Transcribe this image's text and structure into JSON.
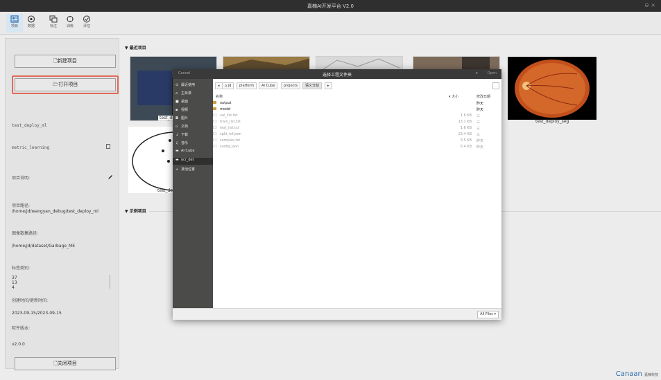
{
  "window": {
    "title": "嘉楠AI开发平台 V2.0",
    "controls": "⊖ ×"
  },
  "toolbar": {
    "items": [
      {
        "label": "项目",
        "icon": "project-icon",
        "active": true
      },
      {
        "label": "数据",
        "icon": "data-icon",
        "active": false
      },
      {
        "label": "标注",
        "icon": "annotate-icon",
        "active": false
      },
      {
        "label": "训练",
        "icon": "train-icon",
        "active": false
      },
      {
        "label": "评估",
        "icon": "evaluate-icon",
        "active": false
      }
    ]
  },
  "left_panel": {
    "new_project": "🗋新建项目",
    "open_project": "🗁打开项目",
    "close_project": "🗋关闭项目",
    "projects": [
      "test_deploy_ml",
      "metric_learning"
    ],
    "description_label": "项目说明:",
    "path_label": "项目路径:",
    "path_value": "/home/jd/wangyan_debug/test_deploy_ml",
    "dataset_label": "图像数集路径:",
    "dataset_value": "/home/jd/dataset/Garbage_ME",
    "categories_label": "标签类别:",
    "categories_values": [
      "37",
      "13",
      "4"
    ],
    "dates_label": "创建时间/更新时间:",
    "dates_value": "2023-09-15/2023-09-15",
    "version_label": "软件版本:",
    "version_value": "v2.0.0"
  },
  "main": {
    "recent_header": "▼ 最近项目",
    "example_header": "▼ 示例项目",
    "recent_cards": [
      {
        "label": "test_deploy"
      },
      {
        "label": ""
      },
      {
        "label": ""
      },
      {
        "label": ""
      },
      {
        "label": "test_deploy_seg"
      }
    ],
    "second_row_label": "test_dep"
  },
  "dialog": {
    "cancel": "Cancel",
    "title": "选择工程文件夹",
    "open": "Open",
    "sidebar": [
      {
        "icon": "⊙",
        "label": "最近使用"
      },
      {
        "icon": "⌂",
        "label": "主目录"
      },
      {
        "icon": "■",
        "label": "桌面"
      },
      {
        "icon": "▪",
        "label": "视频"
      },
      {
        "icon": "◘",
        "label": "图片"
      },
      {
        "icon": "▫",
        "label": "文档"
      },
      {
        "icon": "↓",
        "label": "下载"
      },
      {
        "icon": "♫",
        "label": "音乐"
      },
      {
        "icon": "▬",
        "label": "AI Cube"
      },
      {
        "icon": "▬",
        "label": "ocr_det"
      },
      {
        "icon": "+",
        "label": "其他位置"
      }
    ],
    "breadcrumbs": [
      "◂",
      "⌂ jd",
      "platform",
      "AI Cube",
      "projects",
      "语义分割",
      "▸"
    ],
    "columns": {
      "name": "名称",
      "size": "▾  大小",
      "modified": "修改日期"
    },
    "files": [
      {
        "name": "output",
        "size": "",
        "modified": "昨天",
        "type": "folder"
      },
      {
        "name": "model",
        "size": "",
        "modified": "昨天",
        "type": "folder"
      },
      {
        "name": "val_list.txt",
        "size": "1.6 KB",
        "modified": "三",
        "type": "file"
      },
      {
        "name": "train_list.txt",
        "size": "13.1 KB",
        "modified": "三",
        "type": "file"
      },
      {
        "name": "test_list.txt",
        "size": "1.6 KB",
        "modified": "三",
        "type": "file"
      },
      {
        "name": "split_inf.json",
        "size": "23.4 KB",
        "modified": "三",
        "type": "file"
      },
      {
        "name": "samples.txt",
        "size": "3.5 KB",
        "modified": "昨天",
        "type": "file"
      },
      {
        "name": "config.json",
        "size": "5.4 KB",
        "modified": "昨天",
        "type": "file"
      }
    ],
    "filter": "All Files ▾"
  },
  "brand": {
    "name": "Canaan",
    "sub": "嘉楠科技"
  },
  "colors": {
    "accent_red": "#e06a5b",
    "brand_blue": "#2f6fae",
    "dialog_sidebar": "#4b4b49"
  }
}
